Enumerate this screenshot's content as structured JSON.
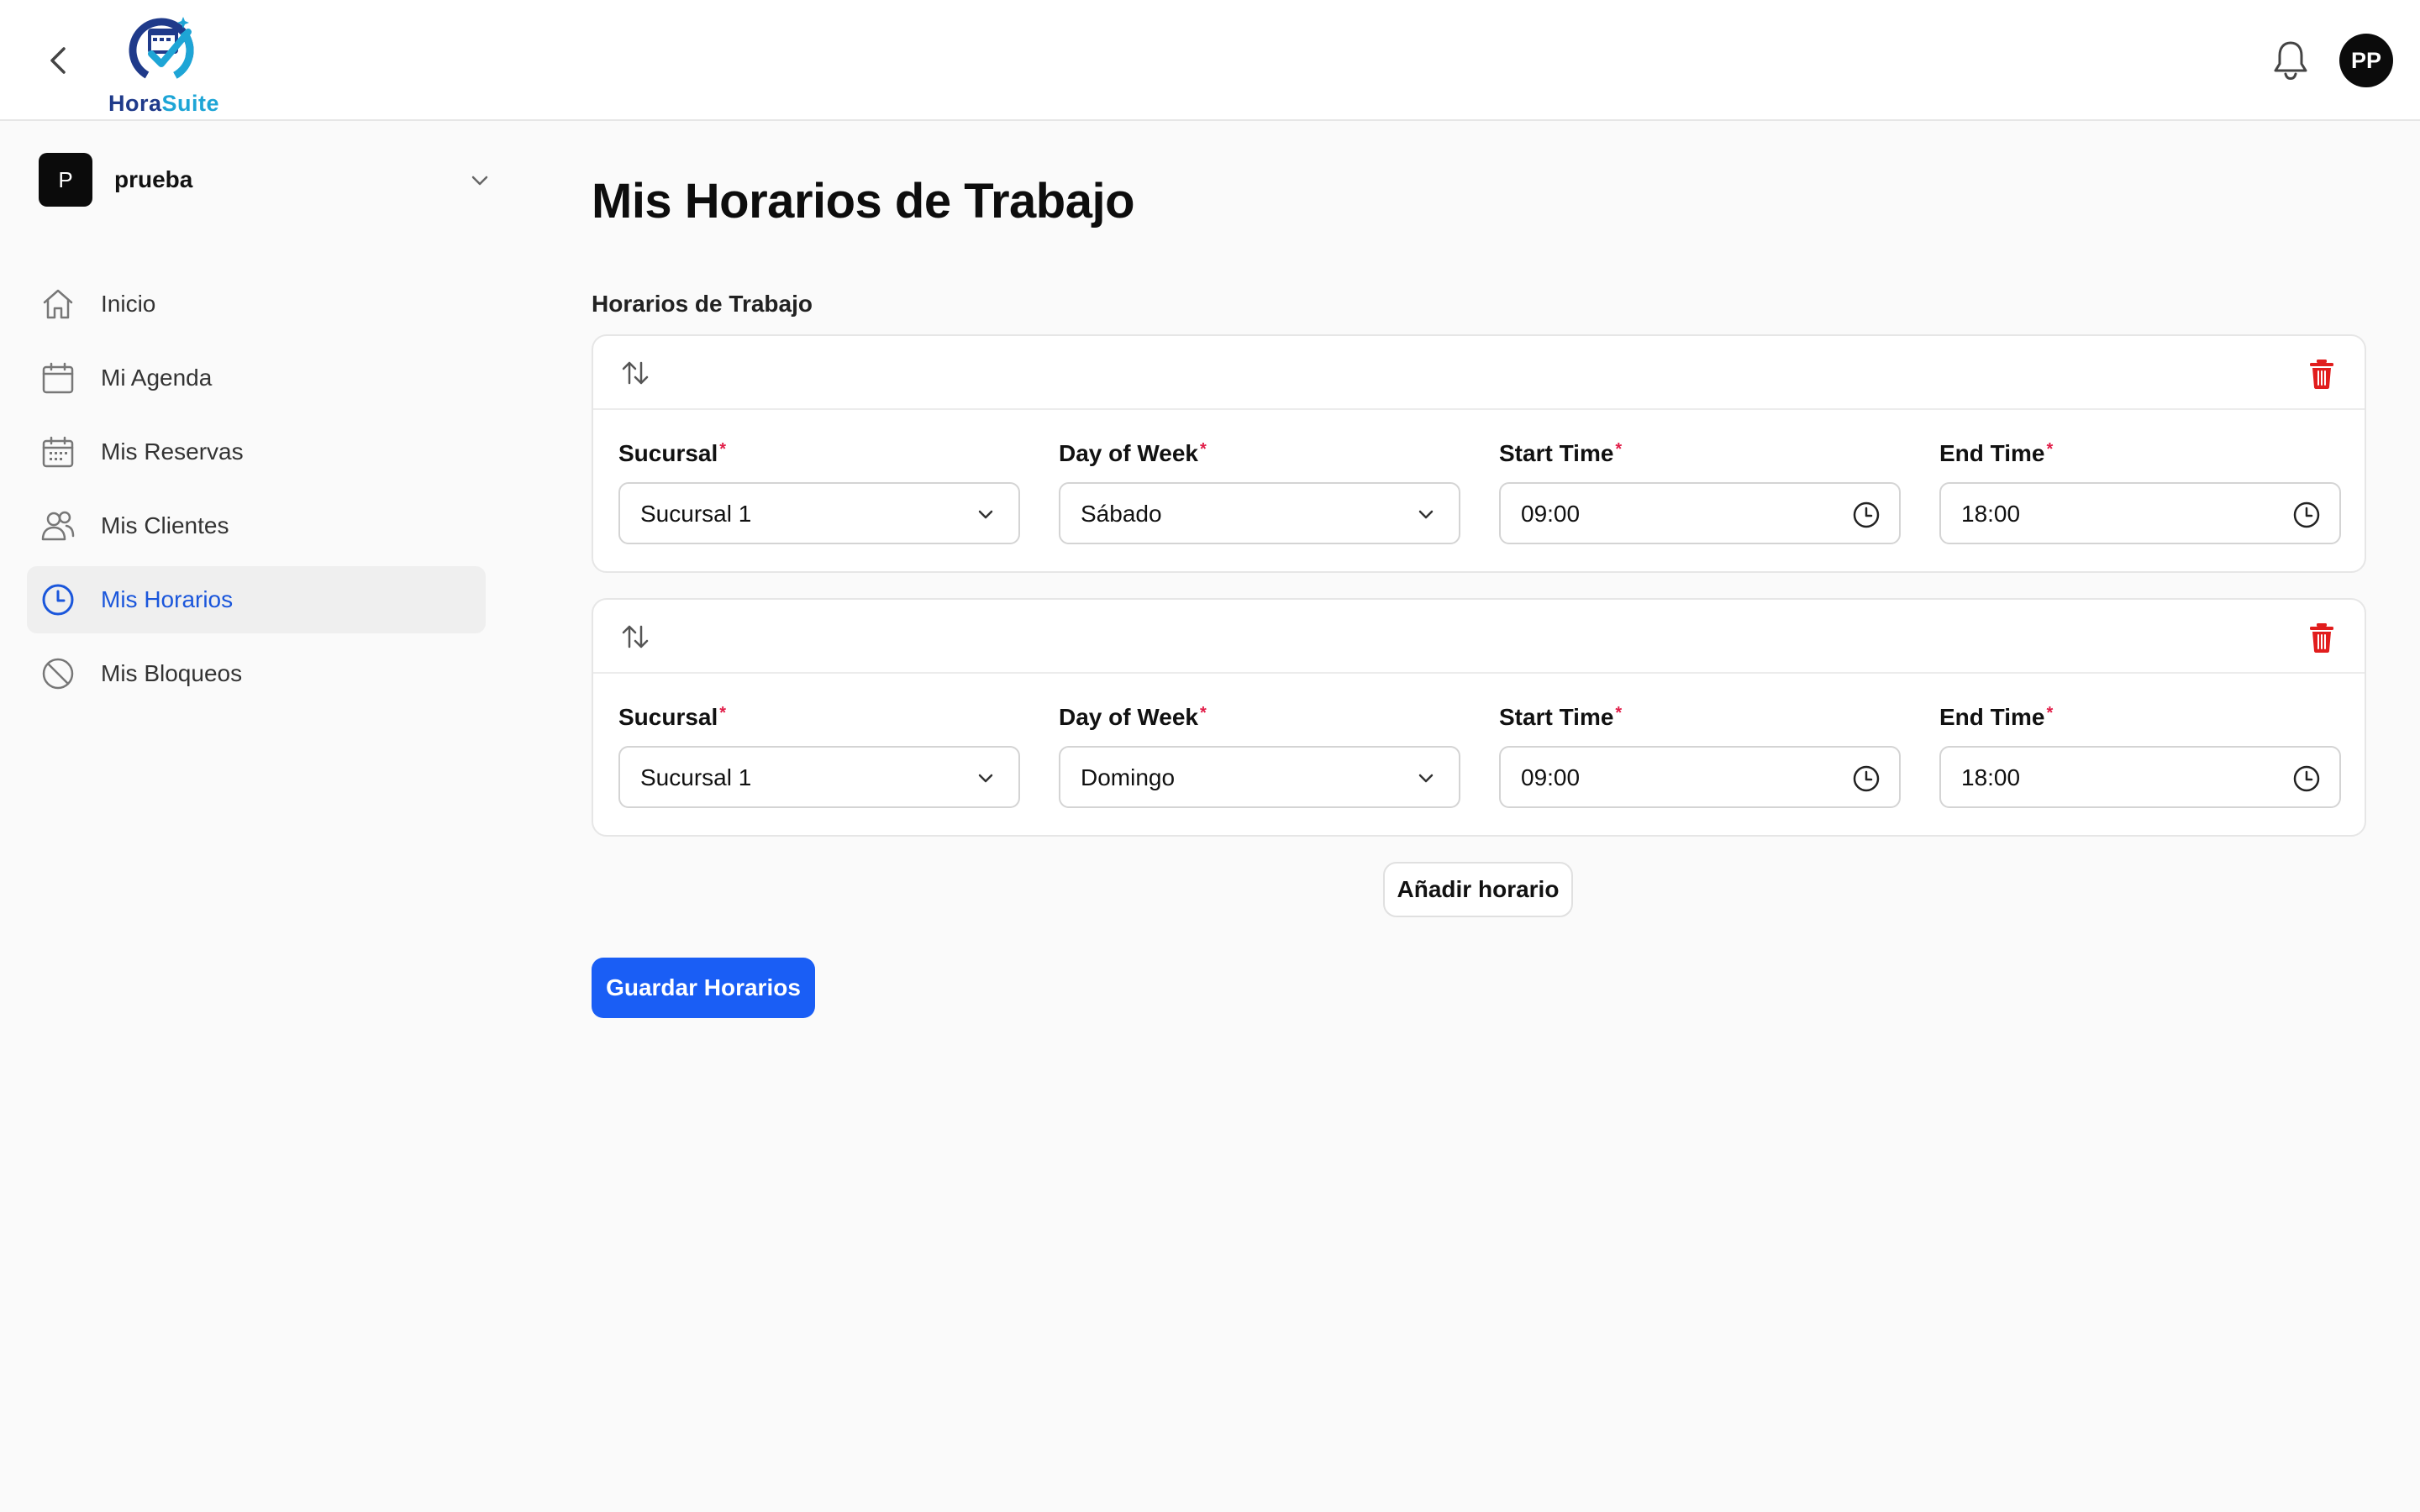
{
  "header": {
    "logo_part1": "Hora",
    "logo_part2": "Suite",
    "back_icon": "chevron-left-icon",
    "notification_icon": "bell-icon",
    "user_initials": "PP"
  },
  "sidebar": {
    "workspace": {
      "initial": "P",
      "name": "prueba"
    },
    "items": [
      {
        "label": "Inicio",
        "icon": "home-icon",
        "active": false
      },
      {
        "label": "Mi Agenda",
        "icon": "calendar-icon",
        "active": false
      },
      {
        "label": "Mis Reservas",
        "icon": "calendar-grid-icon",
        "active": false
      },
      {
        "label": "Mis Clientes",
        "icon": "users-icon",
        "active": false
      },
      {
        "label": "Mis Horarios",
        "icon": "clock-icon",
        "active": true
      },
      {
        "label": "Mis Bloqueos",
        "icon": "ban-icon",
        "active": false
      }
    ]
  },
  "main": {
    "title": "Mis Horarios de Trabajo",
    "section_label": "Horarios de Trabajo",
    "field_labels": {
      "branch": "Sucursal",
      "day": "Day of Week",
      "start": "Start Time",
      "end": "End Time",
      "required_marker": "*"
    },
    "schedules": [
      {
        "branch": "Sucursal 1",
        "day": "Sábado",
        "start": "09:00",
        "end": "18:00"
      },
      {
        "branch": "Sucursal 1",
        "day": "Domingo",
        "start": "09:00",
        "end": "18:00"
      }
    ],
    "add_label": "Añadir horario",
    "save_label": "Guardar Horarios"
  },
  "colors": {
    "primary": "#1a5ef5",
    "active_nav_text": "#1a56db",
    "delete": "#e11d1d",
    "required": "#e11d48"
  }
}
